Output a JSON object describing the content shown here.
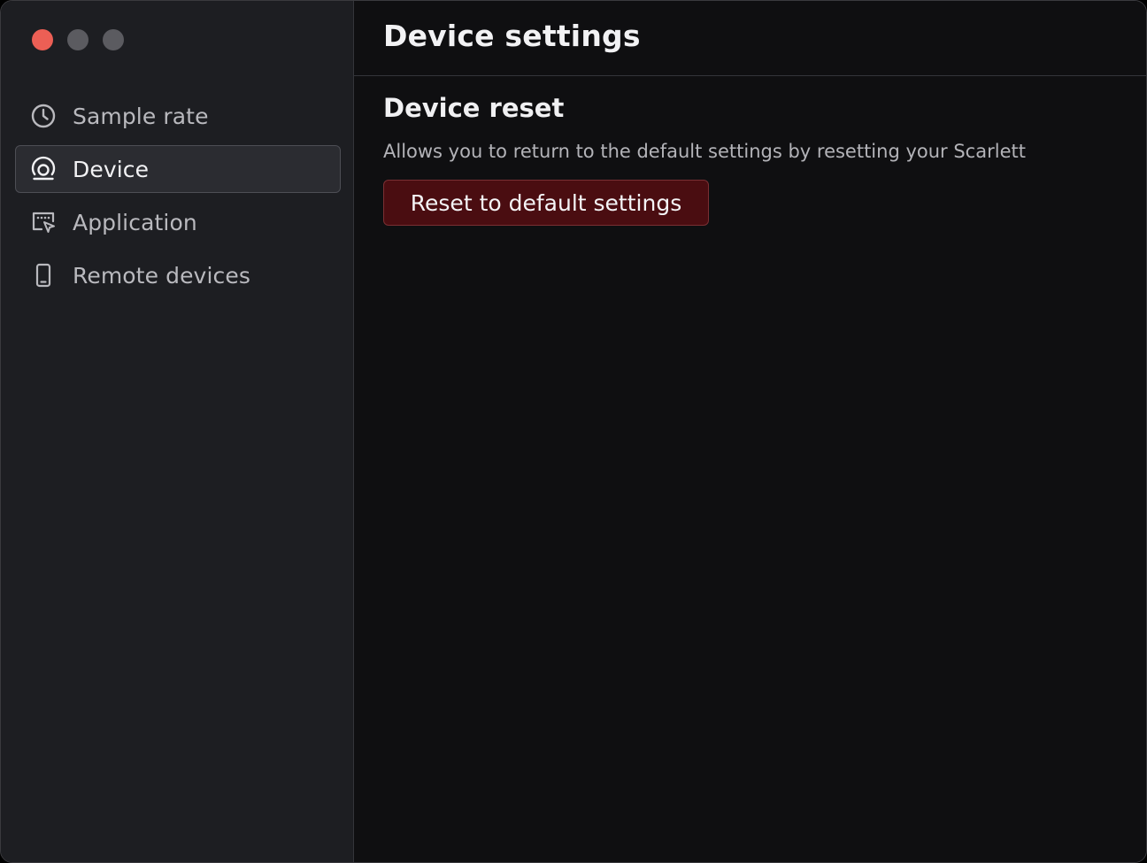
{
  "window": {
    "controls": {
      "close_color": "#ec5f55",
      "minimize_color": "#5b5b60",
      "zoom_color": "#5b5b60"
    }
  },
  "sidebar": {
    "items": [
      {
        "label": "Sample rate",
        "icon": "clock-icon",
        "active": false
      },
      {
        "label": "Device",
        "icon": "device-ring-icon",
        "active": true
      },
      {
        "label": "Application",
        "icon": "application-window-icon",
        "active": false
      },
      {
        "label": "Remote devices",
        "icon": "phone-icon",
        "active": false
      }
    ]
  },
  "main": {
    "title": "Device settings",
    "section": {
      "title": "Device reset",
      "description": "Allows you to return to the default settings by resetting your Scarlett",
      "button_label": "Reset to default settings",
      "button_color": "#4a0d11"
    }
  }
}
